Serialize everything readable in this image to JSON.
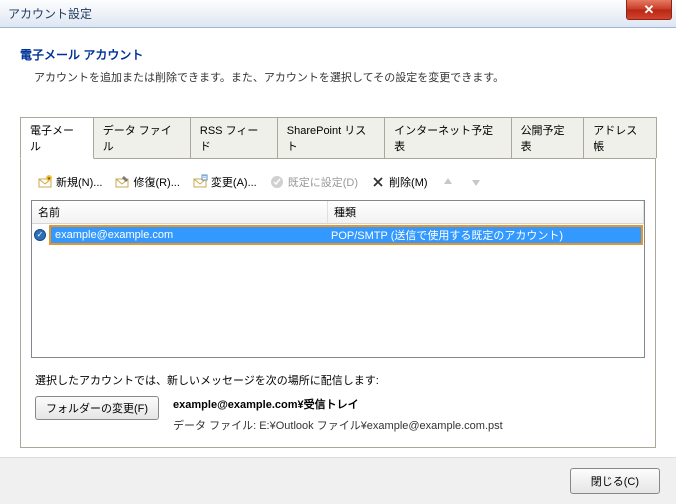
{
  "window": {
    "title": "アカウント設定"
  },
  "header": {
    "title": "電子メール アカウント",
    "description": "アカウントを追加または削除できます。また、アカウントを選択してその設定を変更できます。"
  },
  "tabs": {
    "items": [
      "電子メール",
      "データ ファイル",
      "RSS フィード",
      "SharePoint リスト",
      "インターネット予定表",
      "公開予定表",
      "アドレス帳"
    ]
  },
  "toolbar": {
    "new": "新規(N)...",
    "repair": "修復(R)...",
    "change": "変更(A)...",
    "default": "既定に設定(D)",
    "delete": "削除(M)"
  },
  "columns": {
    "name": "名前",
    "type": "種類"
  },
  "accounts": [
    {
      "name": "example@example.com",
      "type": "POP/SMTP (送信で使用する既定のアカウント)"
    }
  ],
  "delivery": {
    "label": "選択したアカウントでは、新しいメッセージを次の場所に配信します:",
    "button": "フォルダーの変更(F)",
    "main": "example@example.com¥受信トレイ",
    "sub": "データ ファイル: E:¥Outlook ファイル¥example@example.com.pst"
  },
  "footer": {
    "close": "閉じる(C)"
  }
}
